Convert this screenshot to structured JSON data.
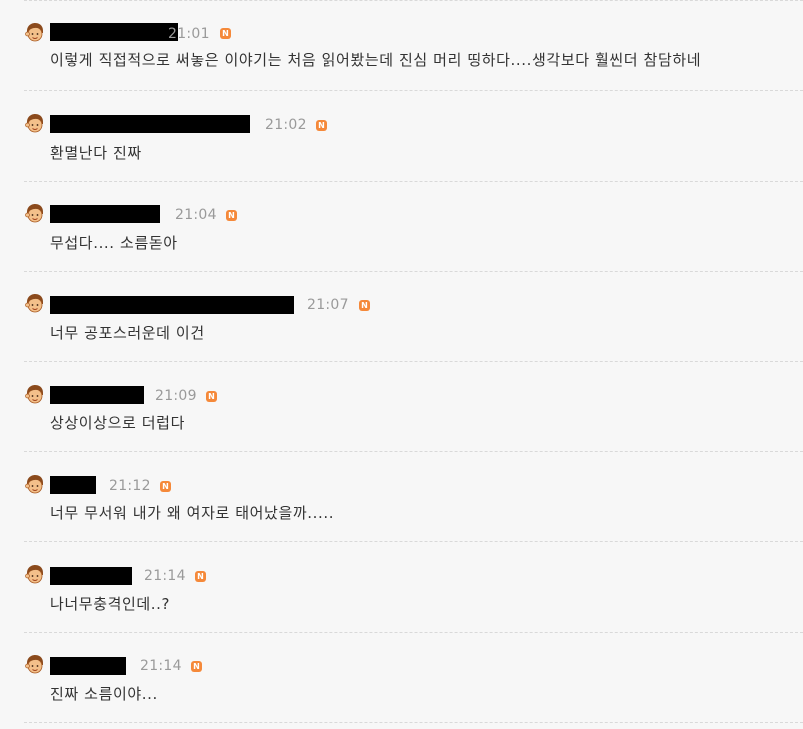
{
  "comments": [
    {
      "time": "21:01",
      "badge": "N",
      "text": "이렇게 직접적으로 써놓은 이야기는 처음 읽어봤는데 진심 머리 띵하다....생각보다 훨씬더 참담하네"
    },
    {
      "time": "21:02",
      "badge": "N",
      "text": "환멸난다 진짜"
    },
    {
      "time": "21:04",
      "badge": "N",
      "text": "무섭다.... 소름돋아"
    },
    {
      "time": "21:07",
      "badge": "N",
      "text": "너무 공포스러운데 이건"
    },
    {
      "time": "21:09",
      "badge": "N",
      "text": "상상이상으로 더럽다"
    },
    {
      "time": "21:12",
      "badge": "N",
      "text": "너무 무서워 내가 왜 여자로 태어났을까....."
    },
    {
      "time": "21:14",
      "badge": "N",
      "text": "나너무충격인데..?"
    },
    {
      "time": "21:14",
      "badge": "N",
      "text": "진짜 소름이야..."
    }
  ],
  "colors": {
    "background": "#f7f7f7",
    "time": "#9a9a9a",
    "badge": "#f5893a",
    "text": "#333333",
    "redaction": "#000000"
  },
  "icons": {
    "avatar": "user-avatar-icon",
    "badge": "new-badge-icon"
  }
}
